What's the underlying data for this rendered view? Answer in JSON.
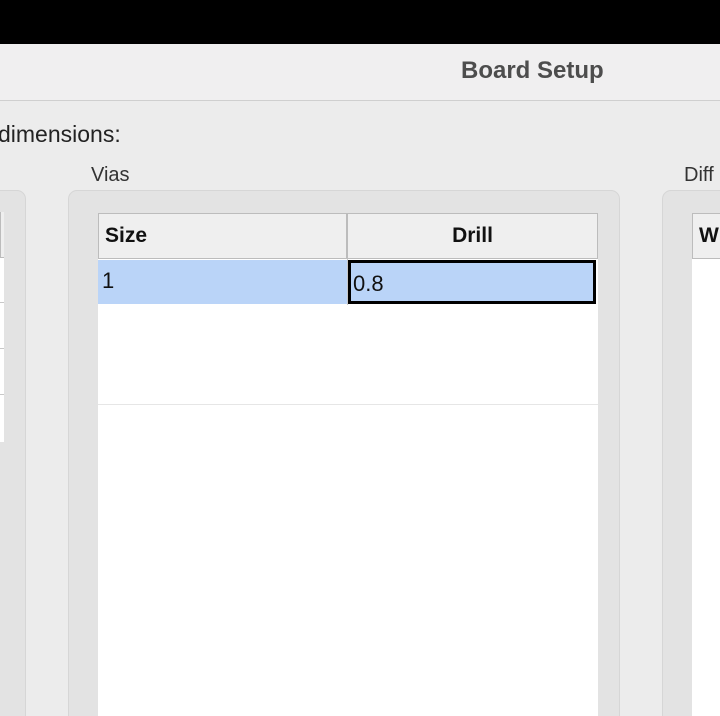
{
  "window": {
    "title": "Board Setup"
  },
  "dimensions_label": "dimensions:",
  "groups": {
    "vias": {
      "label": "Vias",
      "columns": [
        "Size",
        "Drill"
      ],
      "rows": [
        {
          "size": "1",
          "drill": "0.8"
        }
      ]
    },
    "diff_pairs": {
      "label": "Diff",
      "columns": [
        "W"
      ]
    }
  }
}
